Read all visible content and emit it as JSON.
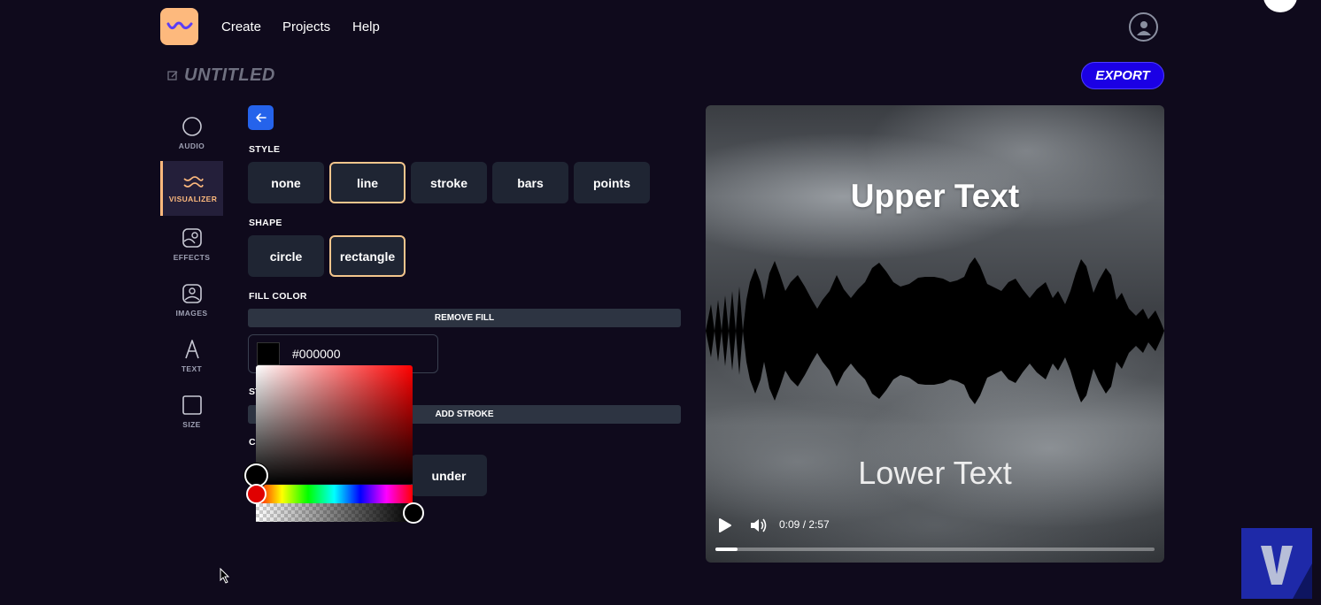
{
  "nav": {
    "create": "Create",
    "projects": "Projects",
    "help": "Help"
  },
  "project": {
    "title": "UNTITLED",
    "export_label": "EXPORT"
  },
  "sidebar": {
    "items": [
      {
        "label": "AUDIO",
        "icon": "circle-icon"
      },
      {
        "label": "VISUALIZER",
        "icon": "wave-icon",
        "active": true
      },
      {
        "label": "EFFECTS",
        "icon": "effects-icon"
      },
      {
        "label": "IMAGES",
        "icon": "image-icon"
      },
      {
        "label": "TEXT",
        "icon": "text-a-icon"
      },
      {
        "label": "SIZE",
        "icon": "square-icon"
      }
    ]
  },
  "panel": {
    "style_label": "STYLE",
    "style_options": [
      "none",
      "line",
      "stroke",
      "bars",
      "points"
    ],
    "style_selected": "line",
    "shape_label": "SHAPE",
    "shape_options": [
      "circle",
      "rectangle"
    ],
    "shape_selected": "rectangle",
    "fill_label": "FILL COLOR",
    "remove_fill_label": "REMOVE FILL",
    "fill_value": "#000000",
    "stroke_label_partial": "ST",
    "add_stroke_label": "ADD STROKE",
    "color_label_partial": "C",
    "under_label": "under"
  },
  "preview": {
    "upper_text": "Upper Text",
    "lower_text": "Lower Text",
    "time": "0:09 / 2:57",
    "progress_percent": 5
  },
  "colors": {
    "accent": "#fdb97d",
    "export": "#1b00e5",
    "back": "#2563eb",
    "background": "#0f0a1c"
  }
}
